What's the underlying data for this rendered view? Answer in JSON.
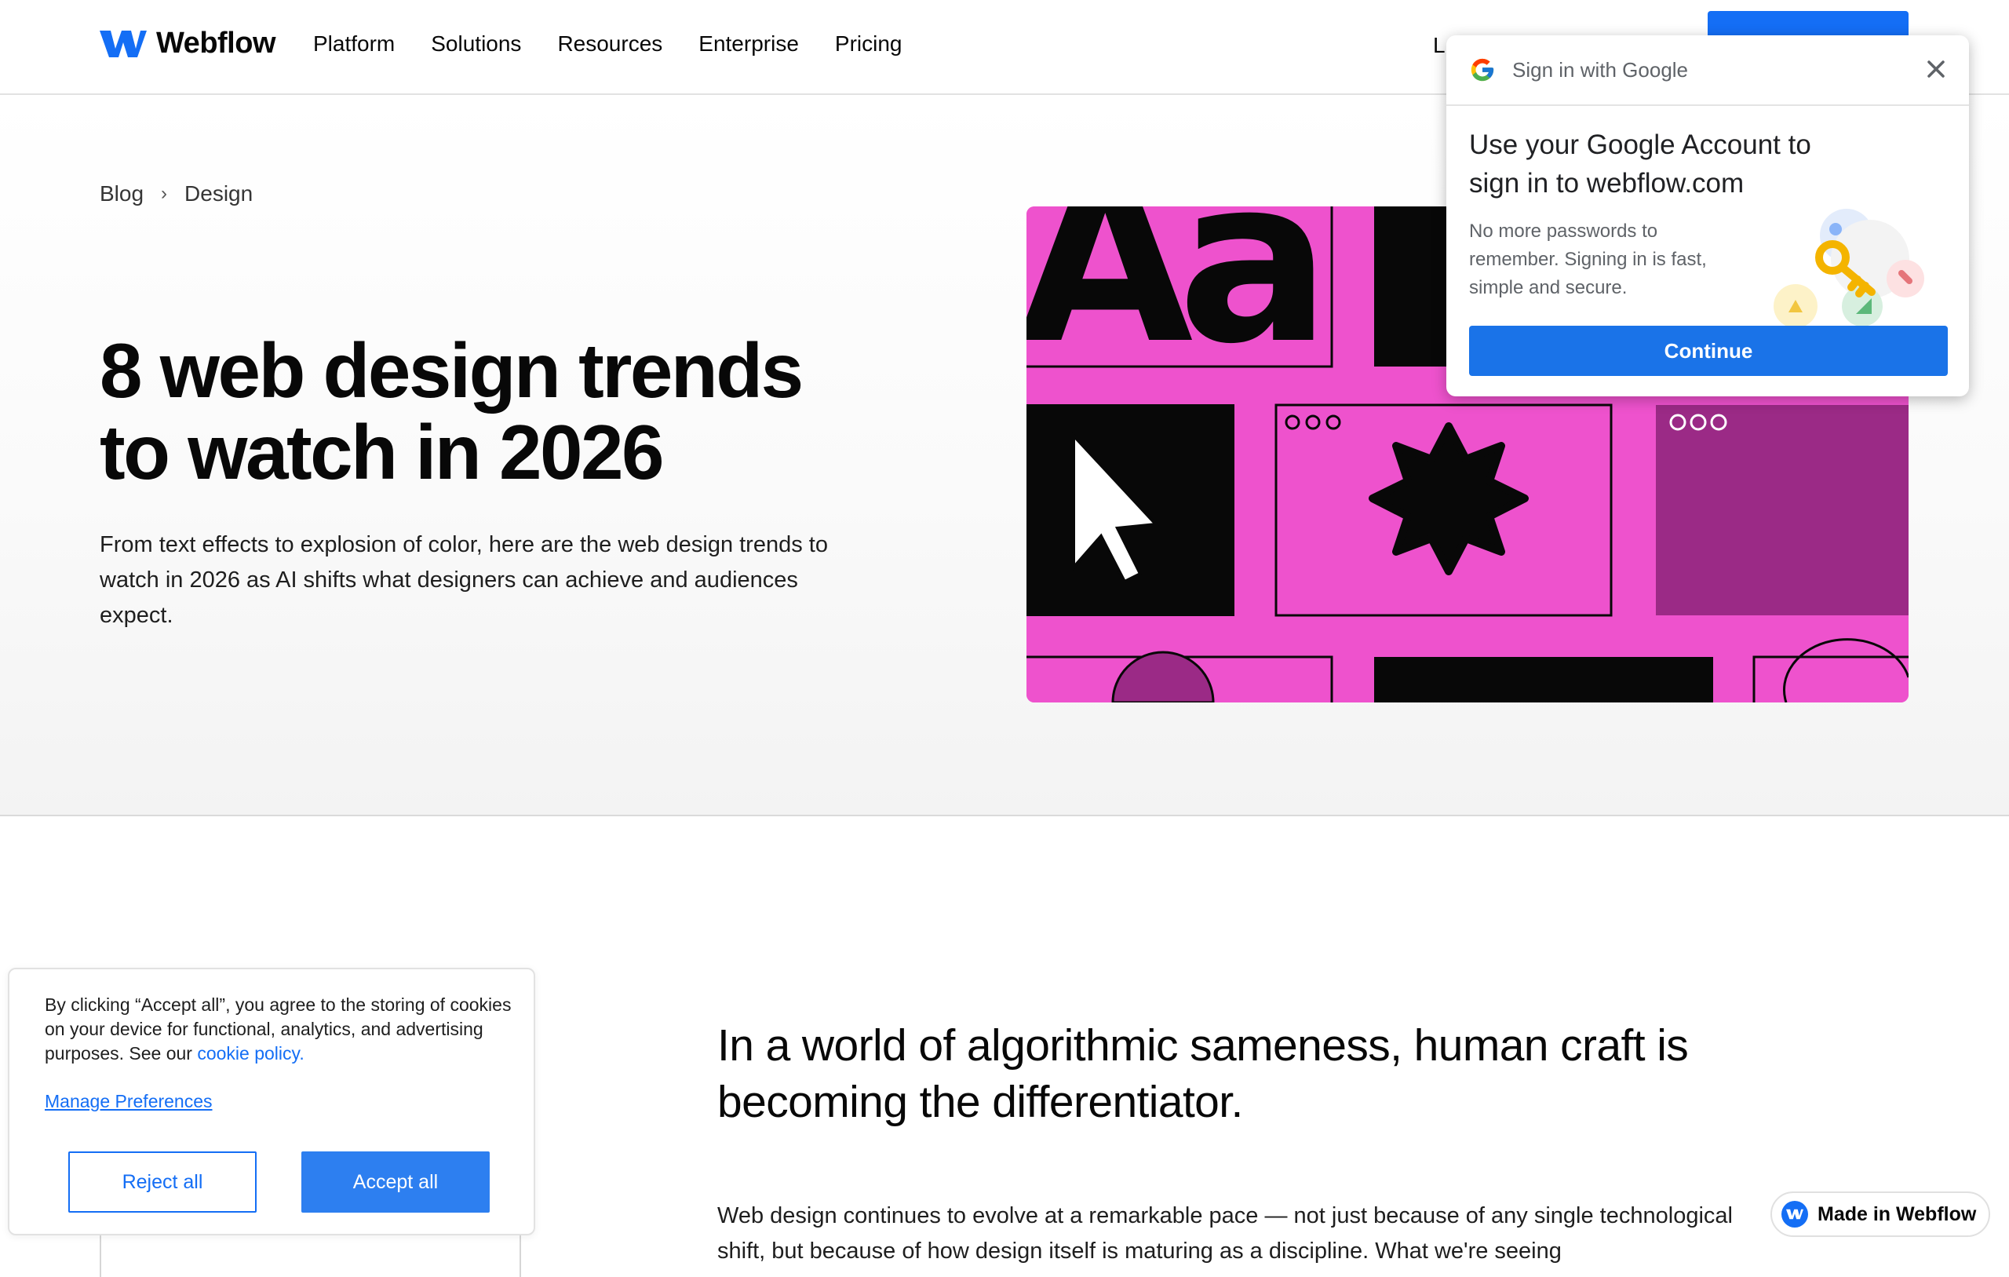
{
  "nav": {
    "brand": "Webflow",
    "links": [
      "Platform",
      "Solutions",
      "Resources",
      "Enterprise",
      "Pricing"
    ],
    "partial_link": "L"
  },
  "breadcrumb": {
    "items": [
      "Blog",
      "Design"
    ],
    "separator": "›"
  },
  "hero": {
    "title": "8 web design trends to watch in 2026",
    "intro": "From text effects to explosion of color, here are the web design trends to watch in 2026 as AI shifts what designers can achieve and audiences expect.",
    "art_text": "Aa"
  },
  "article": {
    "lede": "In a world of algorithmic sameness, human craft is becoming the differentiator.",
    "body": "Web design continues to evolve at a remarkable pace — not just because of any single technological shift, but because of how design itself is maturing as a discipline. What we're seeing"
  },
  "google_popup": {
    "header": "Sign in with Google",
    "heading": "Use your Google Account to sign in to webflow.com",
    "description": "No more passwords to remember. Signing in is fast, simple and secure.",
    "button": "Continue"
  },
  "cookie_banner": {
    "text": "By clicking “Accept all”, you agree to the storing of cookies on your device for functional, analytics, and advertising purposes. See our ",
    "link": "cookie policy.",
    "manage": "Manage Preferences",
    "reject": "Reject all",
    "accept": "Accept all"
  },
  "badge": {
    "label": "Made in Webflow"
  },
  "colors": {
    "brand_blue": "#146ef5",
    "google_blue": "#1a73e8",
    "hero_pink": "#ee52cd",
    "hero_purple": "#9b2a86",
    "ink": "#080808"
  }
}
